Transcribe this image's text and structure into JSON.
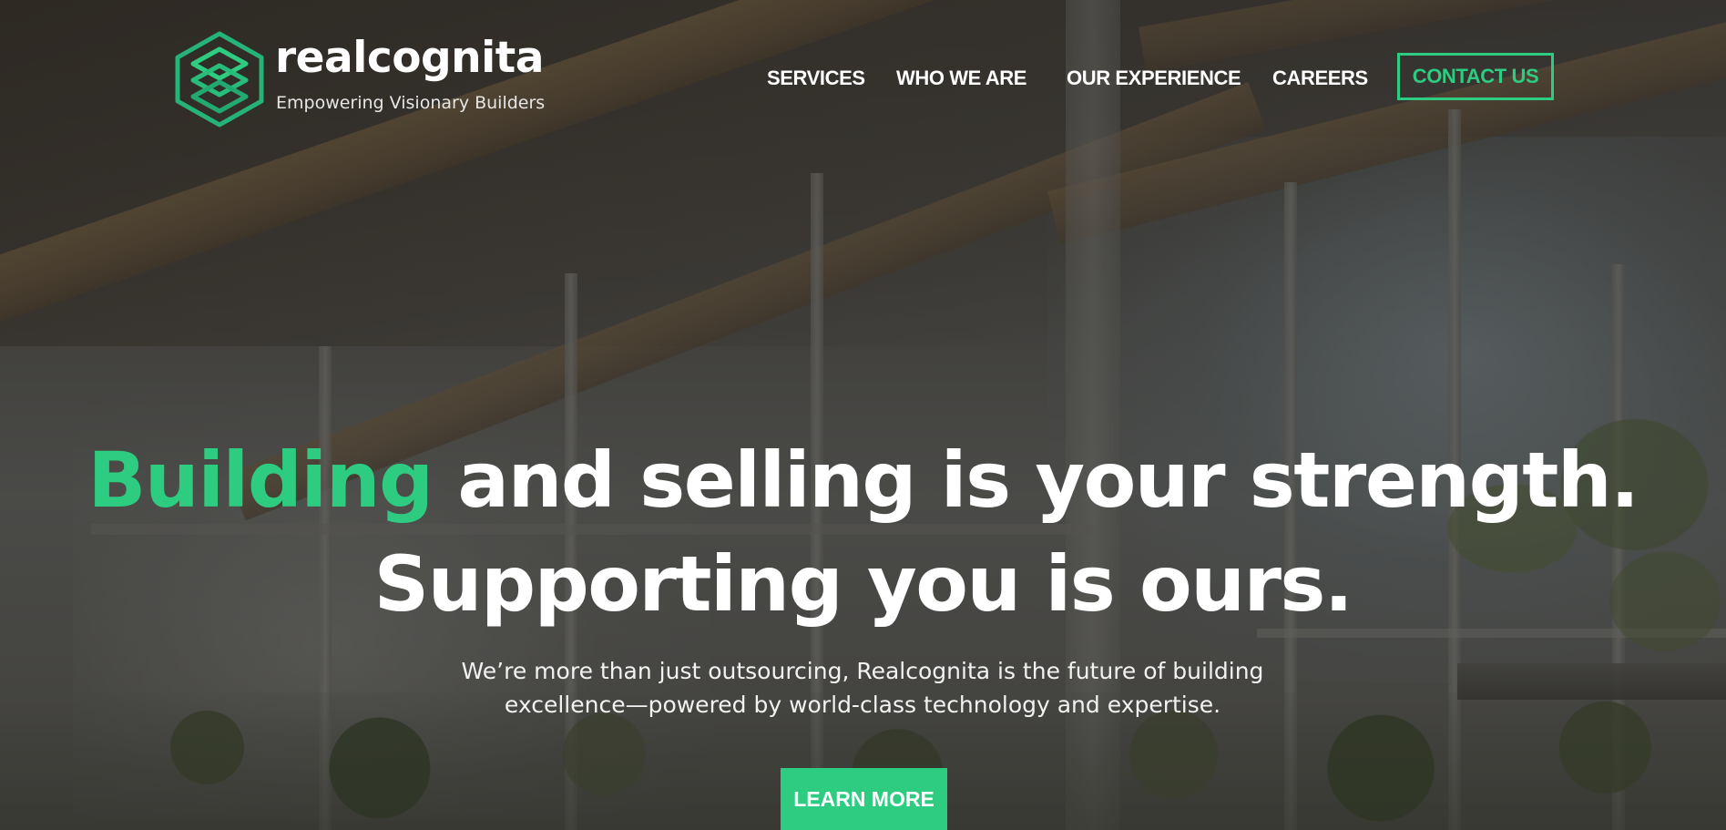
{
  "brand": {
    "name": "realcognita",
    "tagline": "Empowering Visionary Builders",
    "logo_icon": "stacked-layers-hexagon-icon"
  },
  "nav": {
    "items": [
      {
        "label": "SERVICES"
      },
      {
        "label": "WHO WE ARE"
      },
      {
        "label": "OUR EXPERIENCE"
      },
      {
        "label": "CAREERS"
      }
    ],
    "contact_label": "CONTACT US"
  },
  "hero": {
    "headline_accent": "Building",
    "headline_rest": " and selling is your strength.",
    "headline_line2": "Supporting you is ours.",
    "subtext_line1": "We’re more than just outsourcing, Realcognita is the future of building",
    "subtext_line2": "excellence—powered by world-class technology and expertise.",
    "cta_label": "LEARN MORE"
  },
  "colors": {
    "accent": "#2ecc80",
    "text": "#ffffff",
    "overlay": "#141414"
  }
}
